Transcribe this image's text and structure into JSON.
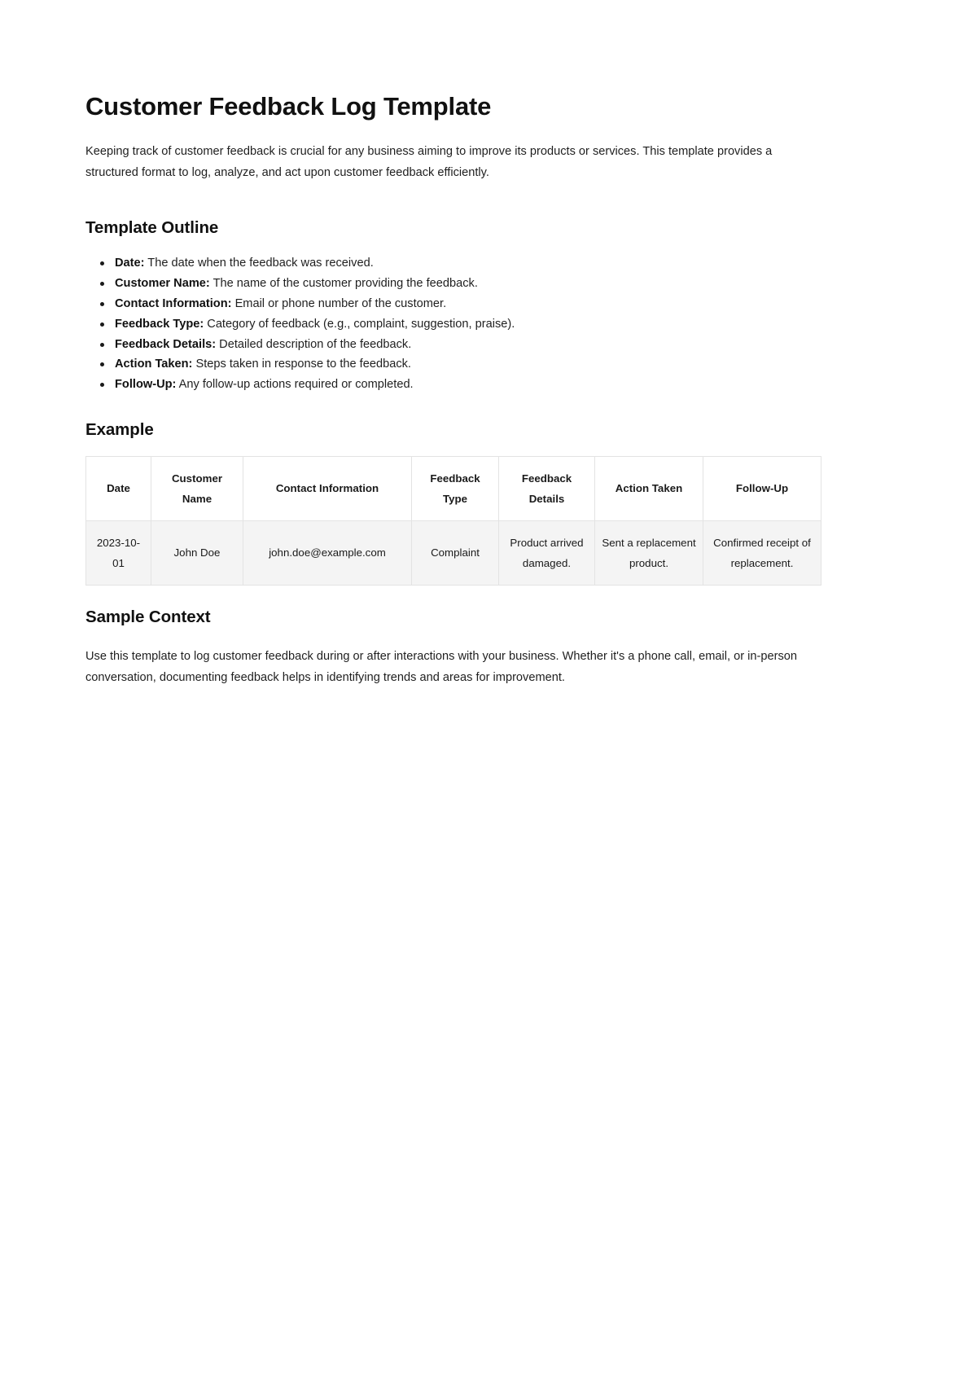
{
  "document": {
    "title": "Customer Feedback Log Template",
    "intro_paragraph": "Keeping track of customer feedback is crucial for any business aiming to improve its products or services. This template provides a structured format to log, analyze, and act upon customer feedback efficiently."
  },
  "outline": {
    "heading": "Template Outline",
    "items": [
      {
        "term": "Date:",
        "description": "The date when the feedback was received."
      },
      {
        "term": "Customer Name:",
        "description": "The name of the customer providing the feedback."
      },
      {
        "term": "Contact Information:",
        "description": "Email or phone number of the customer."
      },
      {
        "term": "Feedback Type:",
        "description": "Category of feedback (e.g., complaint, suggestion, praise)."
      },
      {
        "term": "Feedback Details:",
        "description": "Detailed description of the feedback."
      },
      {
        "term": "Action Taken:",
        "description": "Steps taken in response to the feedback."
      },
      {
        "term": "Follow-Up:",
        "description": "Any follow-up actions required or completed."
      }
    ]
  },
  "example": {
    "heading": "Example",
    "table": {
      "headers": [
        "Date",
        "Customer Name",
        "Contact Information",
        "Feedback Type",
        "Feedback Details",
        "Action Taken",
        "Follow-Up"
      ],
      "rows": [
        [
          "2023-10-01",
          "John Doe",
          "john.doe@example.com",
          "Complaint",
          "Product arrived damaged.",
          "Sent a replacement product.",
          "Confirmed receipt of replacement."
        ]
      ]
    }
  },
  "sample_context": {
    "heading": "Sample Context",
    "paragraph": "Use this template to log customer feedback during or after interactions with your business. Whether it's a phone call, email, or in-person conversation, documenting feedback helps in identifying trends and areas for improvement."
  },
  "colors": {
    "page_background": "#ffffff",
    "text": "#1a1a1a",
    "heading": "#111111",
    "table_border": "#e3e3e3",
    "table_row_background": "#f4f4f4",
    "table_header_background": "#ffffff"
  }
}
